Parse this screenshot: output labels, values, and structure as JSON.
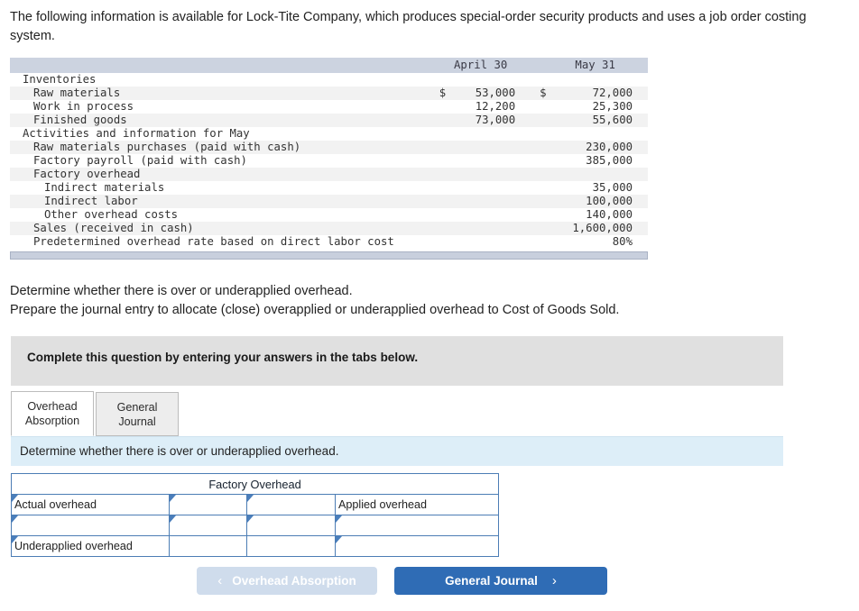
{
  "intro": {
    "text": "The following information is available for Lock-Tite Company, which produces special-order security products and uses a job order costing system."
  },
  "facts_table": {
    "columns": [
      "",
      "April 30",
      "May 31"
    ],
    "rows": [
      {
        "label": "Inventories",
        "indent": 0,
        "cur1": "",
        "v1": "",
        "cur2": "",
        "v2": ""
      },
      {
        "label": "Raw materials",
        "indent": 1,
        "cur1": "$",
        "v1": "53,000",
        "cur2": "$",
        "v2": "72,000"
      },
      {
        "label": "Work in process",
        "indent": 1,
        "cur1": "",
        "v1": "12,200",
        "cur2": "",
        "v2": "25,300"
      },
      {
        "label": "Finished goods",
        "indent": 1,
        "cur1": "",
        "v1": "73,000",
        "cur2": "",
        "v2": "55,600"
      },
      {
        "label": "Activities and information for May",
        "indent": 0,
        "cur1": "",
        "v1": "",
        "cur2": "",
        "v2": ""
      },
      {
        "label": "Raw materials purchases (paid with cash)",
        "indent": 1,
        "cur1": "",
        "v1": "",
        "cur2": "",
        "v2": "230,000"
      },
      {
        "label": "Factory payroll (paid with cash)",
        "indent": 1,
        "cur1": "",
        "v1": "",
        "cur2": "",
        "v2": "385,000"
      },
      {
        "label": "Factory overhead",
        "indent": 1,
        "cur1": "",
        "v1": "",
        "cur2": "",
        "v2": ""
      },
      {
        "label": "Indirect materials",
        "indent": 2,
        "cur1": "",
        "v1": "",
        "cur2": "",
        "v2": "35,000"
      },
      {
        "label": "Indirect labor",
        "indent": 2,
        "cur1": "",
        "v1": "",
        "cur2": "",
        "v2": "100,000"
      },
      {
        "label": "Other overhead costs",
        "indent": 2,
        "cur1": "",
        "v1": "",
        "cur2": "",
        "v2": "140,000"
      },
      {
        "label": "Sales (received in cash)",
        "indent": 1,
        "cur1": "",
        "v1": "",
        "cur2": "",
        "v2": "1,600,000"
      },
      {
        "label": "Predetermined overhead rate based on direct labor cost",
        "indent": 1,
        "cur1": "",
        "v1": "",
        "cur2": "",
        "v2": "80%"
      }
    ]
  },
  "requirements": {
    "line1": "Determine whether there is over or underapplied overhead.",
    "line2": "Prepare the journal entry to allocate (close) overapplied or underapplied overhead to Cost of Goods Sold."
  },
  "banner": {
    "text": "Complete this question by entering your answers in the tabs below."
  },
  "tabs": [
    {
      "label": "Overhead Absorption",
      "line1": "Overhead",
      "line2": "Absorption",
      "active": true
    },
    {
      "label": "General Journal",
      "line1": "General",
      "line2": "Journal",
      "active": false
    }
  ],
  "instruction": {
    "text": "Determine whether there is over or underapplied overhead."
  },
  "worksheet": {
    "title": "Factory Overhead",
    "rows": [
      {
        "a": "Actual overhead",
        "b": "",
        "c": "",
        "d": "Applied overhead"
      },
      {
        "a": "",
        "b": "",
        "c": "",
        "d": ""
      },
      {
        "a": "Underapplied overhead",
        "b": "",
        "c": "",
        "d": ""
      }
    ]
  },
  "nav": {
    "prev_label": "Overhead Absorption",
    "prev_icon": "chevron-left-icon",
    "prev_glyph": "‹",
    "next_label": "General Journal",
    "next_icon": "chevron-right-icon",
    "next_glyph": "›"
  },
  "colors": {
    "header_band": "#ccd3e0",
    "banner_gray": "#e0e0e0",
    "instruction_blue": "#ddeef8",
    "sheet_header_blue": "#7cabdd",
    "sheet_border_blue": "#4c7db5",
    "button_primary": "#2f6cb5",
    "button_disabled": "#cfdcec"
  }
}
